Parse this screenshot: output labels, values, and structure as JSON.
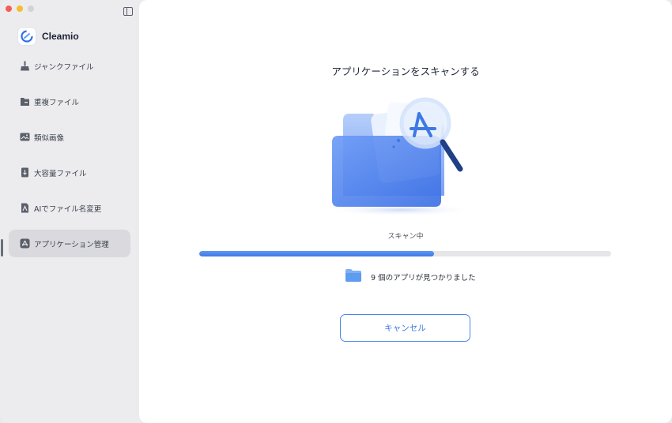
{
  "app": {
    "name": "Cleamio"
  },
  "sidebar": {
    "items": [
      {
        "label": "ジャンクファイル",
        "icon": "broom-icon"
      },
      {
        "label": "重複ファイル",
        "icon": "duplicate-folder-icon"
      },
      {
        "label": "類似画像",
        "icon": "image-icon"
      },
      {
        "label": "大容量ファイル",
        "icon": "large-file-icon"
      },
      {
        "label": "AIでファイル名変更",
        "icon": "ai-rename-icon"
      },
      {
        "label": "アプリケーション管理",
        "icon": "app-store-icon",
        "active": true
      }
    ]
  },
  "main": {
    "title": "アプリケーションをスキャンする",
    "status": "スキャン中",
    "progress": 0.57,
    "found_text": "9 個のアプリが見つかりました",
    "cancel_label": "キャンセル"
  },
  "colors": {
    "accent": "#3d79e3",
    "progress_fill": "#4a84ec",
    "active_item_bg": "#d9d9de"
  }
}
